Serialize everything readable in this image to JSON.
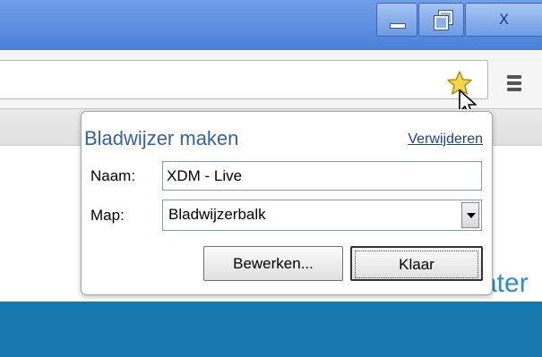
{
  "window": {
    "minimize_icon": "minimize-icon",
    "maximize_icon": "restore-icon",
    "close_label": "X"
  },
  "toolbar": {
    "star_icon": "bookmark-star-icon",
    "menu_icon": "hamburger-menu-icon"
  },
  "bookmark_bubble": {
    "title": "Bladwijzer maken",
    "remove_label": "Verwijderen",
    "name_label": "Naam:",
    "name_value": "XDM - Live",
    "folder_label": "Map:",
    "folder_value": "Bladwijzerbalk",
    "edit_button": "Bewerken...",
    "done_button": "Klaar"
  },
  "page": {
    "partial_text": "ater"
  },
  "colors": {
    "titlebar": "#5a8ee0",
    "page_band": "#1878b0",
    "link": "#1a3fa0",
    "bubble_title": "#3460b0"
  }
}
